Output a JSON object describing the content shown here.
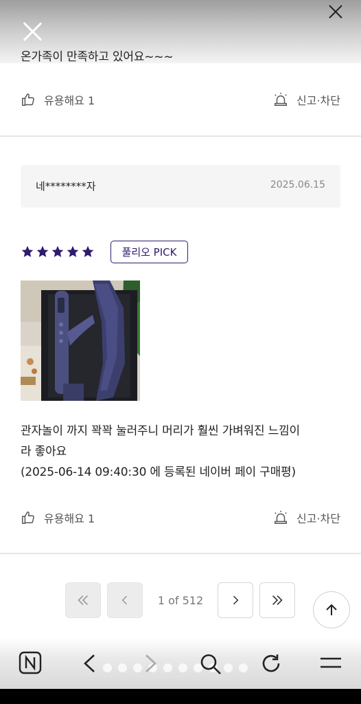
{
  "prev_review": {
    "text": "온가족이 만족하고 있어요~~~",
    "helpful_label": "유용해요 1",
    "report_label": "신고·차단"
  },
  "review": {
    "user_name": "네********자",
    "date": "2025.06.15",
    "rating": 5,
    "star_color": "#2e1a6e",
    "badge": "풀리오 PICK",
    "text_line1": "관자놀이 까지 꽉꽉 눌러주니 머리가 훨씬 가벼워진 느낌이",
    "text_line2": "라 좋아요",
    "text_line3": "(2025-06-14 09:40:30 에 등록된 네이버 페이 구매평)",
    "helpful_label": "유용해요 1",
    "report_label": "신고·차단"
  },
  "pagination": {
    "page_info": "1 of 512",
    "first_icon": "double-chevron-left-icon",
    "prev_icon": "chevron-left-icon",
    "next_icon": "chevron-right-icon",
    "last_icon": "double-chevron-right-icon"
  },
  "browser_bar": {
    "icons": [
      "naver-logo-icon",
      "back-icon",
      "forward-icon",
      "search-icon",
      "refresh-icon",
      "menu-icon"
    ],
    "dot_count": 10,
    "active_dot": 7
  }
}
